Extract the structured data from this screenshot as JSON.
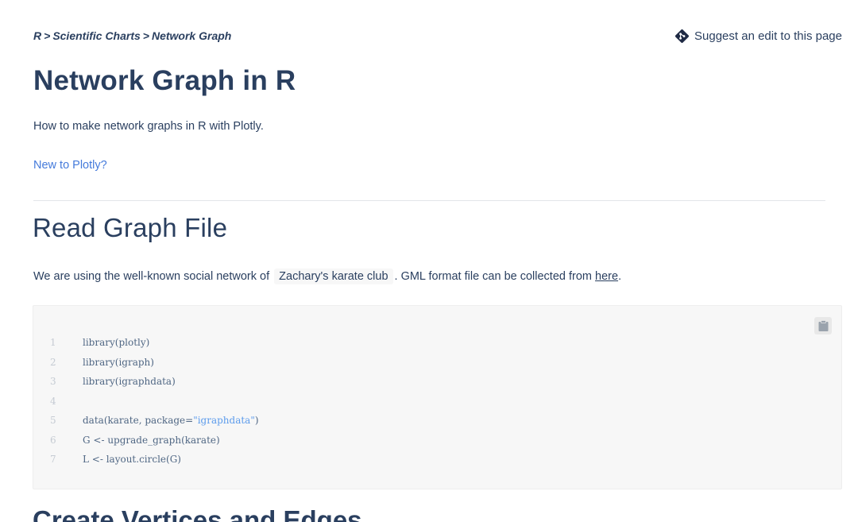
{
  "breadcrumb": {
    "items": [
      "R",
      "Scientific Charts",
      "Network Graph"
    ],
    "separator": ">"
  },
  "suggest_edit": {
    "label": "Suggest an edit to this page",
    "icon": "git-diamond-icon"
  },
  "page": {
    "title": "Network Graph in R",
    "description": "How to make network graphs in R with Plotly.",
    "new_to_link": "New to Plotly?"
  },
  "section1": {
    "heading": "Read Graph File",
    "para_prefix": "We are using the well-known social network of",
    "inline_code": "Zachary's karate club",
    "para_middle": ". GML format file can be collected from",
    "link": "here",
    "para_suffix": "."
  },
  "codeblock": {
    "copy_icon": "clipboard-icon",
    "lines": [
      {
        "n": "1",
        "code": "library(plotly)"
      },
      {
        "n": "2",
        "code": "library(igraph)"
      },
      {
        "n": "3",
        "code": "library(igraphdata)"
      },
      {
        "n": "4",
        "code": ""
      },
      {
        "n": "5",
        "code_before": "data(karate, package=",
        "string": "\"igraphdata\"",
        "code_after": ")"
      },
      {
        "n": "6",
        "code": "G <- upgrade_graph(karate)"
      },
      {
        "n": "7",
        "code": "L <- layout.circle(G)"
      }
    ]
  },
  "section2": {
    "heading": "Create Vertices and Edges"
  },
  "colors": {
    "text": "#2a3f5f",
    "link": "#447adb",
    "code_bg": "#f7f7f7",
    "string": "#5d9cec",
    "line_number": "#c5cbd3"
  }
}
